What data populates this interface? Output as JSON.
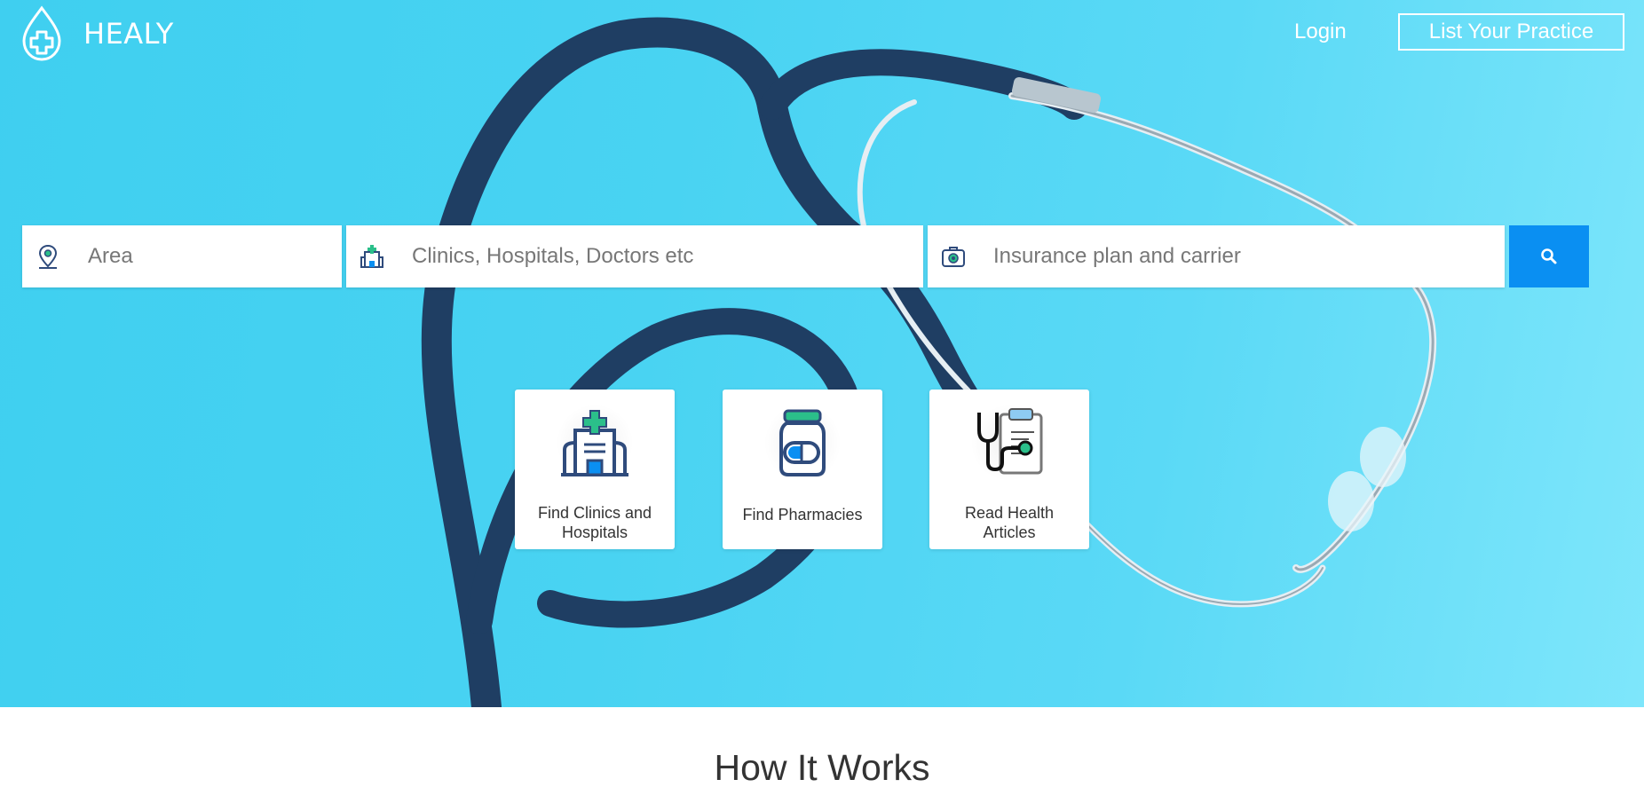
{
  "brand": {
    "name": "HEALY",
    "logo_icon": "drop-plus-icon"
  },
  "nav": {
    "login_label": "Login",
    "list_practice_label": "List Your Practice"
  },
  "search": {
    "area": {
      "placeholder": "Area",
      "icon": "map-pin-icon"
    },
    "facility": {
      "placeholder": "Clinics, Hospitals, Doctors etc",
      "icon": "hospital-icon"
    },
    "insurance": {
      "placeholder": "Insurance plan and carrier",
      "icon": "medical-bag-icon"
    },
    "submit_icon": "search-icon",
    "submit_color": "#0a8ff2"
  },
  "quick_links": [
    {
      "label": "Find Clinics and Hospitals",
      "icon": "hospital-building-icon"
    },
    {
      "label": "Find Pharmacies",
      "icon": "pill-bottle-icon"
    },
    {
      "label": "Read Health Articles",
      "icon": "stethoscope-clipboard-icon"
    }
  ],
  "section": {
    "how_it_works_title": "How It Works"
  },
  "colors": {
    "hero_background": "#47d2f2",
    "accent_blue": "#0a8ff2",
    "icon_navy": "#2f4b7c",
    "icon_green": "#2bbf8a"
  }
}
